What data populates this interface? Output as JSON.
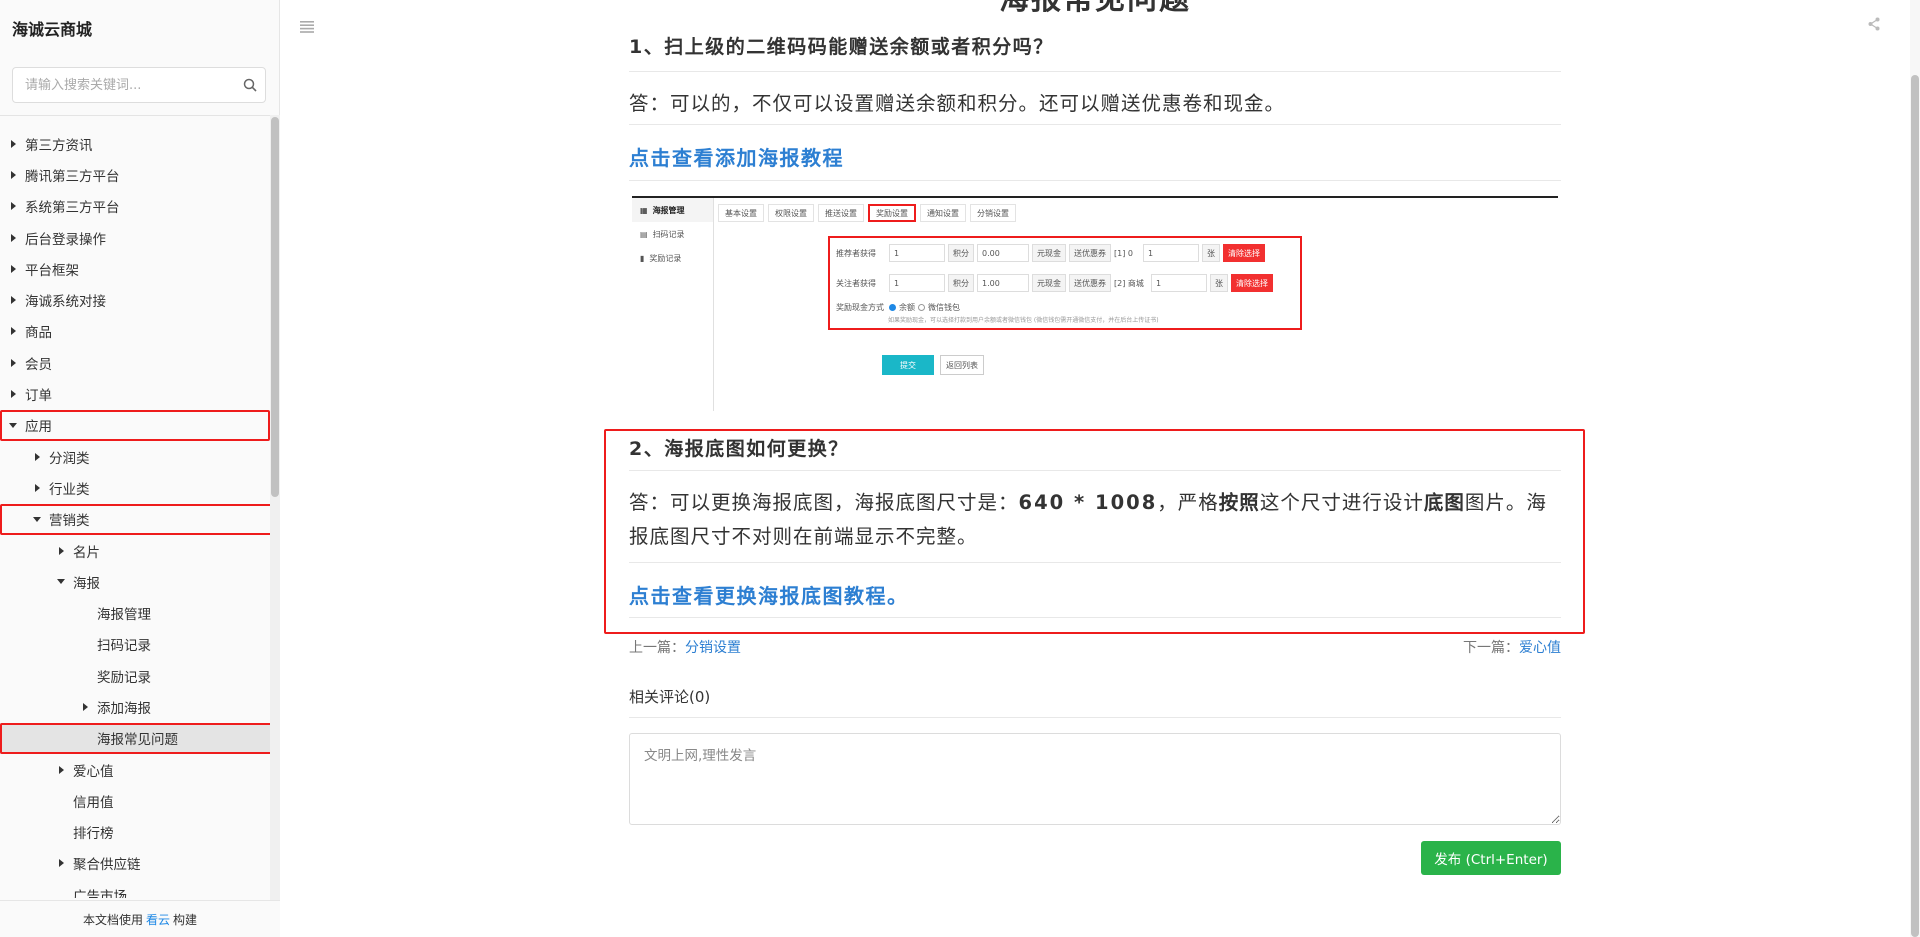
{
  "sidebar": {
    "title": "海诚云商城",
    "search_placeholder": "请输入搜索关键词...",
    "items": [
      {
        "label": "第三方资讯",
        "level": 0,
        "arrow": "right"
      },
      {
        "label": "腾讯第三方平台",
        "level": 0,
        "arrow": "right"
      },
      {
        "label": "系统第三方平台",
        "level": 0,
        "arrow": "right"
      },
      {
        "label": "后台登录操作",
        "level": 0,
        "arrow": "right"
      },
      {
        "label": "平台框架",
        "level": 0,
        "arrow": "right"
      },
      {
        "label": "海诚系统对接",
        "level": 0,
        "arrow": "right"
      },
      {
        "label": "商品",
        "level": 0,
        "arrow": "right"
      },
      {
        "label": "会员",
        "level": 0,
        "arrow": "right"
      },
      {
        "label": "订单",
        "level": 0,
        "arrow": "right"
      },
      {
        "label": "应用",
        "level": 0,
        "arrow": "down",
        "highlight": true
      },
      {
        "label": "分润类",
        "level": 1,
        "arrow": "right"
      },
      {
        "label": "行业类",
        "level": 1,
        "arrow": "right"
      },
      {
        "label": "营销类",
        "level": 1,
        "arrow": "down",
        "highlight": true
      },
      {
        "label": "名片",
        "level": 2,
        "arrow": "right"
      },
      {
        "label": "海报",
        "level": 2,
        "arrow": "down"
      },
      {
        "label": "海报管理",
        "level": 3,
        "arrow": "none"
      },
      {
        "label": "扫码记录",
        "level": 3,
        "arrow": "none"
      },
      {
        "label": "奖励记录",
        "level": 3,
        "arrow": "none"
      },
      {
        "label": "添加海报",
        "level": 3,
        "arrow": "right"
      },
      {
        "label": "海报常见问题",
        "level": 3,
        "arrow": "none",
        "selected": true,
        "highlight": true
      },
      {
        "label": "爱心值",
        "level": 2,
        "arrow": "right"
      },
      {
        "label": "信用值",
        "level": 2,
        "arrow": "none"
      },
      {
        "label": "排行榜",
        "level": 2,
        "arrow": "none"
      },
      {
        "label": "聚合供应链",
        "level": 2,
        "arrow": "right"
      },
      {
        "label": "广告市场",
        "level": 2,
        "arrow": "none"
      }
    ],
    "footer": {
      "prefix": "本文档使用",
      "link": "看云",
      "suffix": "构建"
    }
  },
  "article": {
    "title": "海报常见问题",
    "q1": "1、扫上级的二维码码能赠送余额或者积分吗？",
    "a1": "答：可以的，不仅可以设置赠送余额和积分。还可以赠送优惠卷和现金。",
    "link1": "点击查看添加海报教程",
    "screenshot": {
      "nav": [
        "海报管理",
        "扫码记录",
        "奖励记录"
      ],
      "tabs": [
        "基本设置",
        "权限设置",
        "推送设置",
        "奖励设置",
        "通知设置",
        "分销设置"
      ],
      "row1": {
        "label": "推荐者获得",
        "v1": "1",
        "u1": "积分",
        "v2": "0.00",
        "u2": "元现金",
        "u3": "送优惠券",
        "v3": "[1] 0",
        "v4": "1",
        "u4": "张",
        "btn": "清除选择"
      },
      "row2": {
        "label": "关注者获得",
        "v1": "1",
        "u1": "积分",
        "v2": "1.00",
        "u2": "元现金",
        "u3": "送优惠券",
        "v3": "[2] 商城",
        "v4": "1",
        "u4": "张",
        "btn": "清除选择"
      },
      "row3": {
        "label": "奖励现金方式",
        "opt1": "余额",
        "opt2": "微信钱包",
        "note": "如果奖励现金，可以选择打款到用户余额或者微信钱包 (微信钱包需开通微信支付，并在后台上传证书)"
      },
      "submit": "提交",
      "back": "返回列表"
    },
    "q2": "2、海报底图如何更换？",
    "a2_parts": [
      "答：可以更换海报底图，海报底图尺寸是：",
      "640 * 1008",
      "，严格",
      "按照",
      "这个尺寸进行设计",
      "底图",
      "图片。海报底图尺寸不对则在前端显示不完整。"
    ],
    "link2": "点击查看更换海报底图教程。",
    "prev_label": "上一篇：",
    "prev_link": "分销设置",
    "next_label": "下一篇：",
    "next_link": "爱心值",
    "comments_title": "相关评论(0)",
    "comment_placeholder": "文明上网,理性发言",
    "publish_label": "发布 (Ctrl+Enter)"
  },
  "colors": {
    "highlight": "#ee1c1c",
    "link": "#2d7fd2",
    "publish": "#2ab34a"
  }
}
